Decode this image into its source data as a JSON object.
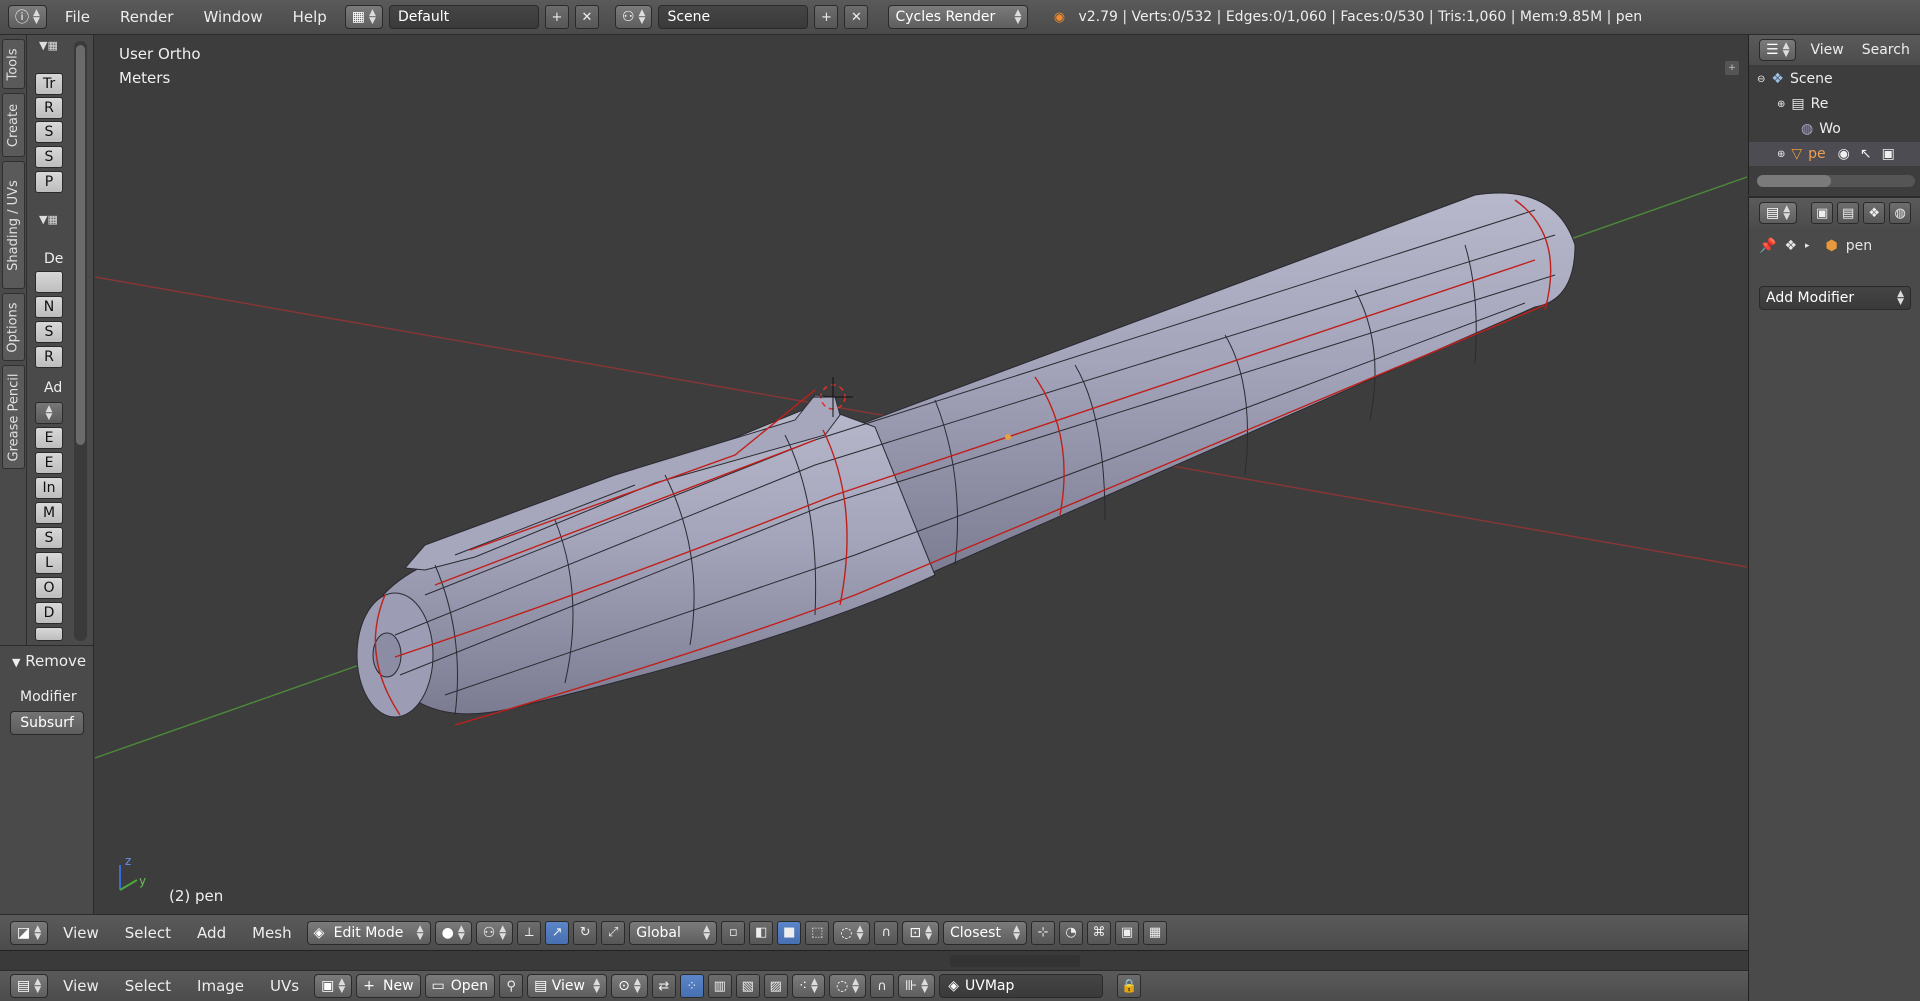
{
  "topbar": {
    "menu": [
      "File",
      "Render",
      "Window",
      "Help"
    ],
    "layout": "Default",
    "scene": "Scene",
    "engine": "Cycles Render",
    "stats": "v2.79 | Verts:0/532 | Edges:0/1,060 | Faces:0/530 | Tris:1,060 | Mem:9.85M | pen"
  },
  "tabs": [
    "Tools",
    "Create",
    "Shading / UVs",
    "Options",
    "Grease Pencil"
  ],
  "toolshelf": {
    "transform_buttons": [
      "Tr",
      "R",
      "S",
      "S",
      "P"
    ],
    "deform_label": "De",
    "deform_buttons": [
      "",
      "N",
      "S",
      "R"
    ],
    "add_label": "Ad",
    "add_buttons": [
      "",
      "E",
      "E",
      "In",
      "M",
      "S",
      "L",
      "O",
      "D",
      ""
    ]
  },
  "ops_panel": {
    "title": "Remove",
    "label": "Modifier",
    "button": "Subsurf"
  },
  "viewport": {
    "view_label": "User Ortho",
    "units_label": "Meters",
    "object_label": "(2) pen",
    "axis_z": "z",
    "axis_y": "y"
  },
  "outliner": {
    "header": [
      "View",
      "Search"
    ],
    "items": [
      {
        "label": "Scene",
        "icon": "scene-icon"
      },
      {
        "label": "Re",
        "icon": "render-layers-icon"
      },
      {
        "label": "Wo",
        "icon": "world-icon"
      },
      {
        "label": "pe",
        "icon": "mesh-object-icon"
      }
    ]
  },
  "properties": {
    "object_name": "pen",
    "add_modifier": "Add Modifier"
  },
  "viewport_header": {
    "menu": [
      "View",
      "Select",
      "Add",
      "Mesh"
    ],
    "mode": "Edit Mode",
    "orientation": "Global",
    "snap": "Closest"
  },
  "uv_header": {
    "menu": [
      "View",
      "Select",
      "Image",
      "UVs"
    ],
    "new_label": "New",
    "open_label": "Open",
    "view_label": "View",
    "uvmap": "UVMap"
  },
  "colors": {
    "background": "#3d3d3d",
    "panel": "#4a4a4a",
    "header": "#555555",
    "mesh_fill": "#9b9bb3",
    "mesh_edge": "#2a2a32",
    "seam": "#c0201a",
    "x_axis": "#8a3535",
    "y_axis": "#4c8a3a",
    "active_blue": "#5680c2"
  }
}
